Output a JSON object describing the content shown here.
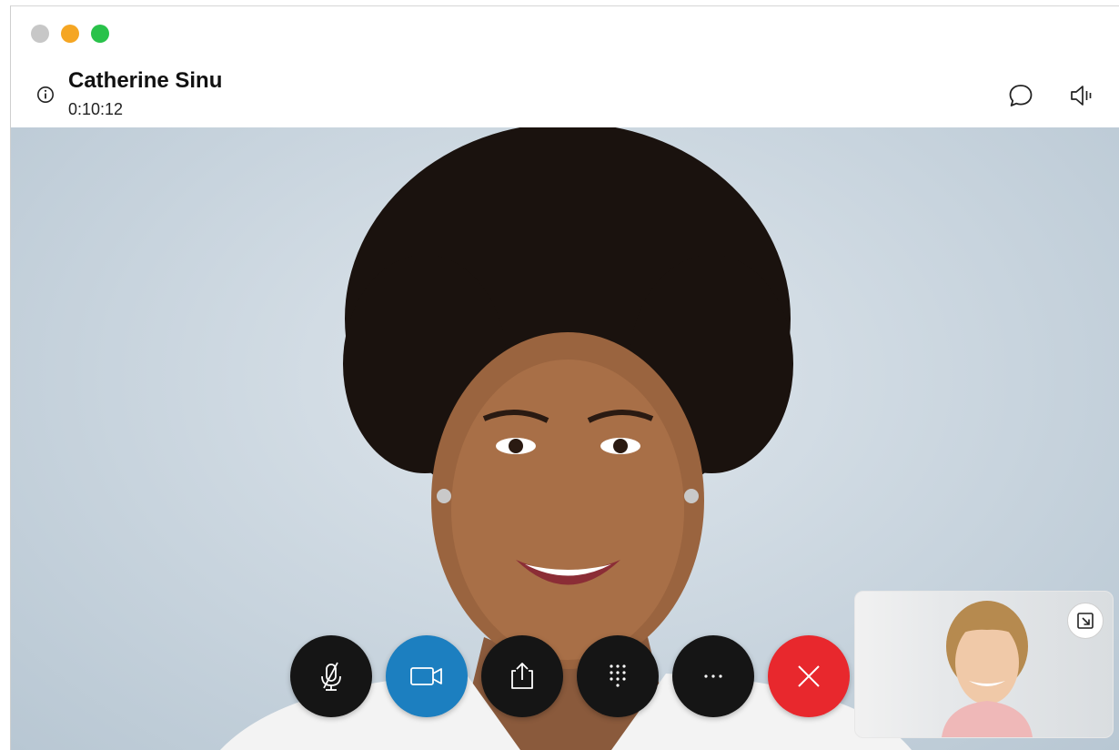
{
  "window": {
    "controls": [
      "close",
      "minimize",
      "maximize"
    ]
  },
  "header": {
    "contact_name": "Catherine Sinu",
    "call_timer": "0:10:12",
    "icons": {
      "info": "info-icon",
      "chat": "chat-icon",
      "audio": "speaker-icon"
    }
  },
  "controls": [
    {
      "name": "mute-button",
      "icon": "microphone-muted-icon"
    },
    {
      "name": "video-button",
      "icon": "video-camera-icon"
    },
    {
      "name": "share-button",
      "icon": "share-upload-icon"
    },
    {
      "name": "keypad-button",
      "icon": "keypad-icon"
    },
    {
      "name": "more-button",
      "icon": "more-dots-icon"
    },
    {
      "name": "end-call-button",
      "icon": "close-x-icon"
    }
  ],
  "self_view": {
    "popout_icon": "popout-icon"
  },
  "colors": {
    "video_on": "#1c7fc0",
    "end_call": "#e8282d",
    "control_bg": "#151515",
    "traffic_close": "#c7c7c7",
    "traffic_min": "#f5a623",
    "traffic_max": "#29c24a"
  }
}
